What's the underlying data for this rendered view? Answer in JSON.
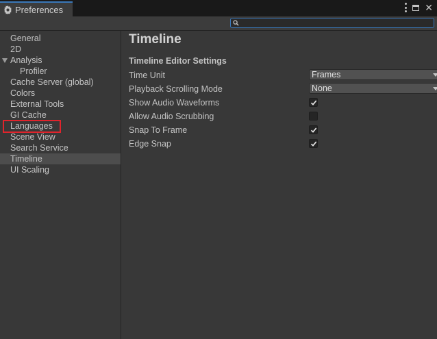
{
  "window": {
    "title": "Preferences"
  },
  "search": {
    "value": "",
    "placeholder": ""
  },
  "sidebar": {
    "items": [
      {
        "label": "General"
      },
      {
        "label": "2D"
      },
      {
        "label": "Analysis"
      },
      {
        "label": "Profiler"
      },
      {
        "label": "Cache Server (global)"
      },
      {
        "label": "Colors"
      },
      {
        "label": "External Tools"
      },
      {
        "label": "GI Cache"
      },
      {
        "label": "Languages"
      },
      {
        "label": "Scene View"
      },
      {
        "label": "Search Service"
      },
      {
        "label": "Timeline"
      },
      {
        "label": "UI Scaling"
      }
    ],
    "selected": "Timeline",
    "highlighted": "Languages"
  },
  "content": {
    "title": "Timeline",
    "section": "Timeline Editor Settings",
    "settings": [
      {
        "label": "Time Unit",
        "type": "dropdown",
        "value": "Frames"
      },
      {
        "label": "Playback Scrolling Mode",
        "type": "dropdown",
        "value": "None"
      },
      {
        "label": "Show Audio Waveforms",
        "type": "checkbox",
        "checked": true
      },
      {
        "label": "Allow Audio Scrubbing",
        "type": "checkbox",
        "checked": false
      },
      {
        "label": "Snap To Frame",
        "type": "checkbox",
        "checked": true
      },
      {
        "label": "Edge Snap",
        "type": "checkbox",
        "checked": true
      }
    ]
  },
  "colors": {
    "accent": "#3a79bb",
    "highlight_box": "#e0242c",
    "background": "#383838"
  },
  "icons": [
    "gear-icon",
    "kebab-menu-icon",
    "maximize-icon",
    "close-icon",
    "search-icon",
    "expand-arrow-icon",
    "dropdown-arrow-icon",
    "checkmark-icon"
  ]
}
